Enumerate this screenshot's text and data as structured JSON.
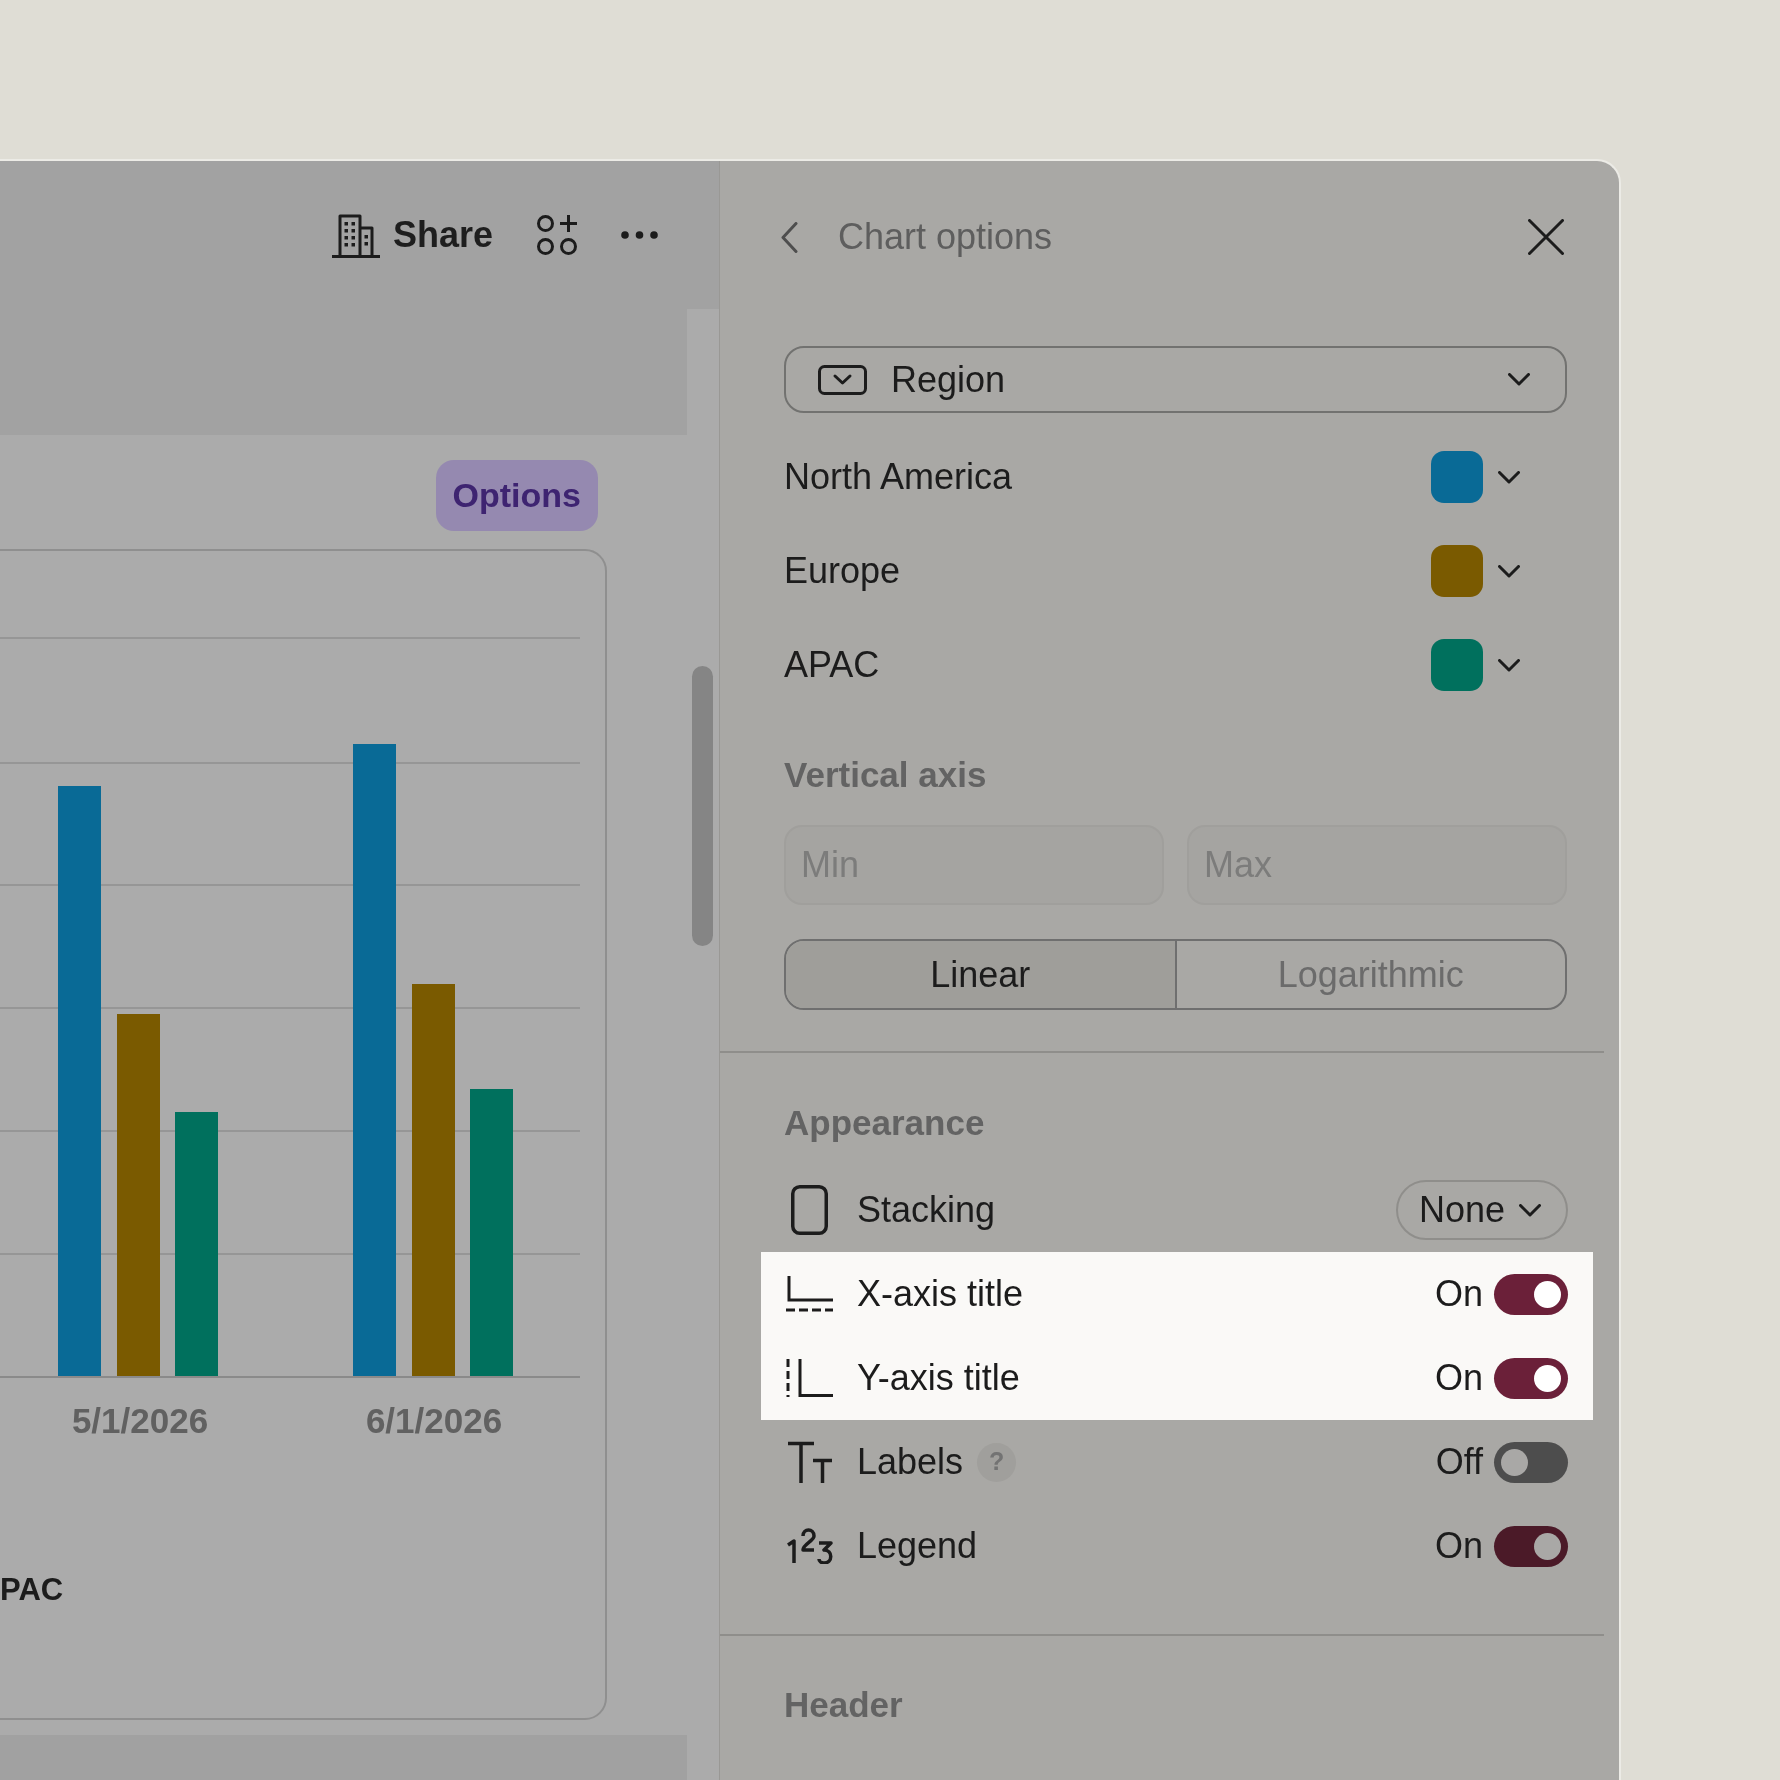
{
  "toolbar": {
    "share_label": "Share"
  },
  "canvas": {
    "options_button": "Options",
    "chart": {
      "categories": [
        "5/1/2026",
        "6/1/2026"
      ],
      "legend_fragment": "PAC"
    }
  },
  "panel": {
    "title": "Chart options",
    "group_by": {
      "value": "Region"
    },
    "series": [
      {
        "name": "North America",
        "color": "#096a96"
      },
      {
        "name": "Europe",
        "color": "#7a5a00"
      },
      {
        "name": "APAC",
        "color": "#00705d"
      }
    ],
    "vertical_axis": {
      "title": "Vertical axis",
      "min": {
        "placeholder": "Min"
      },
      "max": {
        "placeholder": "Max"
      },
      "scale": [
        {
          "label": "Linear",
          "selected": true
        },
        {
          "label": "Logarithmic",
          "selected": false
        }
      ]
    },
    "appearance": {
      "title": "Appearance",
      "rows": [
        {
          "kind": "dropdown",
          "label": "Stacking",
          "value": "None",
          "highlighted": false
        },
        {
          "kind": "toggle",
          "label": "X-axis title",
          "status": "On",
          "on": true,
          "highlighted": true
        },
        {
          "kind": "toggle",
          "label": "Y-axis title",
          "status": "On",
          "on": true,
          "highlighted": true
        },
        {
          "kind": "toggle",
          "label": "Labels",
          "help": "?",
          "status": "Off",
          "on": false,
          "highlighted": false
        },
        {
          "kind": "toggle",
          "label": "Legend",
          "status": "On",
          "on": true,
          "highlighted": false
        }
      ]
    },
    "header_section": {
      "title": "Header"
    }
  }
}
